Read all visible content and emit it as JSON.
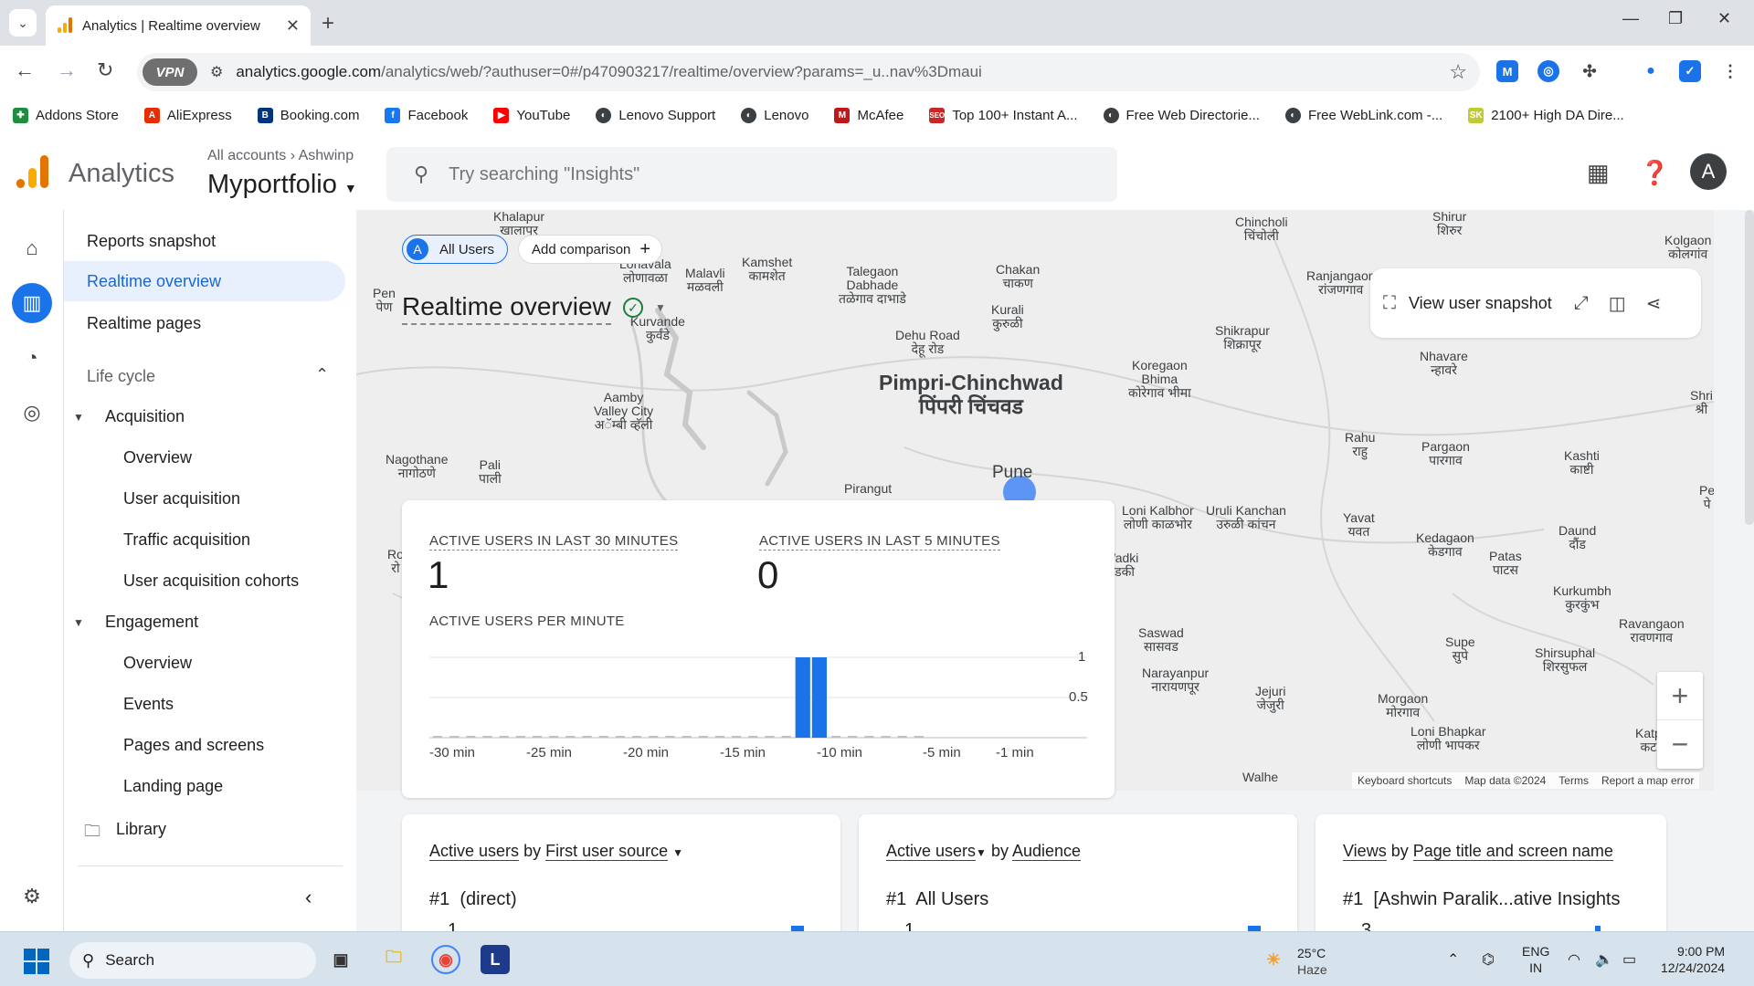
{
  "browser": {
    "tab_title": "Analytics | Realtime overview",
    "url_host": "analytics.google.com",
    "url_path": "/analytics/web/?authuser=0#/p470903217/realtime/overview?params=_u..nav%3Dmaui",
    "vpn_label": "VPN",
    "bookmarks": [
      {
        "label": "Addons Store",
        "color": "#1e8e3e"
      },
      {
        "label": "AliExpress",
        "color": "#e62e04"
      },
      {
        "label": "Booking.com",
        "color": "#003580"
      },
      {
        "label": "Facebook",
        "color": "#1877f2"
      },
      {
        "label": "YouTube",
        "color": "#ff0000"
      },
      {
        "label": "Lenovo Support",
        "color": "#3c4043"
      },
      {
        "label": "Lenovo",
        "color": "#3c4043"
      },
      {
        "label": "McAfee",
        "color": "#c01818"
      },
      {
        "label": "Top 100+ Instant A...",
        "color": "#c62828"
      },
      {
        "label": "Free Web Directorie...",
        "color": "#3c4043"
      },
      {
        "label": "Free WebLink.com -...",
        "color": "#3c4043"
      },
      {
        "label": "2100+ High DA Dire...",
        "color": "#c0ca33"
      }
    ]
  },
  "header": {
    "brand": "Analytics",
    "crumb_all": "All accounts",
    "crumb_account": "Ashwinp",
    "property": "Myportfolio",
    "search_placeholder": "Try searching \"Insights\"",
    "avatar_letter": "A"
  },
  "nav": {
    "reports_snapshot": "Reports snapshot",
    "realtime_overview": "Realtime overview",
    "realtime_pages": "Realtime pages",
    "life_cycle": "Life cycle",
    "acquisition": "Acquisition",
    "acq_items": [
      "Overview",
      "User acquisition",
      "Traffic acquisition",
      "User acquisition cohorts"
    ],
    "engagement": "Engagement",
    "eng_items": [
      "Overview",
      "Events",
      "Pages and screens",
      "Landing page"
    ],
    "library": "Library"
  },
  "realtime": {
    "all_users": "All Users",
    "all_users_letter": "A",
    "add_comparison": "Add comparison",
    "title": "Realtime overview",
    "view_snapshot": "View user snapshot",
    "active_30_label": "ACTIVE USERS IN LAST 30 MINUTES",
    "active_30_value": "1",
    "active_5_label": "ACTIVE USERS IN LAST 5 MINUTES",
    "active_5_value": "0",
    "per_minute_label": "ACTIVE USERS PER MINUTE",
    "map_attrib": [
      "Keyboard shortcuts",
      "Map data ©2024",
      "Terms",
      "Report a map error"
    ]
  },
  "chart_data": {
    "type": "bar",
    "title": "ACTIVE USERS PER MINUTE",
    "x_tick_labels": [
      "-30 min",
      "-25 min",
      "-20 min",
      "-15 min",
      "-10 min",
      "-5 min",
      "-1 min"
    ],
    "y_tick_labels": [
      "1",
      "0.5"
    ],
    "ylim": [
      0,
      1
    ],
    "categories": [
      "-30",
      "-29",
      "-28",
      "-27",
      "-26",
      "-25",
      "-24",
      "-23",
      "-22",
      "-21",
      "-20",
      "-19",
      "-18",
      "-17",
      "-16",
      "-15",
      "-14",
      "-13",
      "-12",
      "-11",
      "-10",
      "-9",
      "-8",
      "-7",
      "-6",
      "-5",
      "-4",
      "-3",
      "-2",
      "-1"
    ],
    "values": [
      0,
      0,
      0,
      0,
      0,
      0,
      0,
      0,
      0,
      0,
      0,
      0,
      0,
      0,
      0,
      0,
      0,
      0,
      0,
      0,
      0,
      0,
      1,
      1,
      0,
      0,
      0,
      0,
      0,
      0
    ],
    "color": "#1a73e8"
  },
  "map_places": {
    "major": [
      "Pimpri-Chinchwad",
      "पिंपरी चिंचवड"
    ],
    "pune": "Pune",
    "pin_count": "3"
  },
  "cards": [
    {
      "metric": "Active users",
      "by": "by",
      "dim": "First user source",
      "rank": "#1",
      "item": "(direct)",
      "value": "1"
    },
    {
      "metric": "Active users",
      "by": "by",
      "dim": "Audience",
      "rank": "#1",
      "item": "All Users",
      "value": "1"
    },
    {
      "metric": "Views",
      "by": "by",
      "dim": "Page title and screen name",
      "rank": "#1",
      "item": "[Ashwin Paralik...ative Insights",
      "value": "3"
    }
  ],
  "taskbar": {
    "search": "Search",
    "temp": "25°C",
    "weather": "Haze",
    "lang1": "ENG",
    "lang2": "IN",
    "time": "9:00 PM",
    "date": "12/24/2024",
    "app_letter": "L"
  }
}
